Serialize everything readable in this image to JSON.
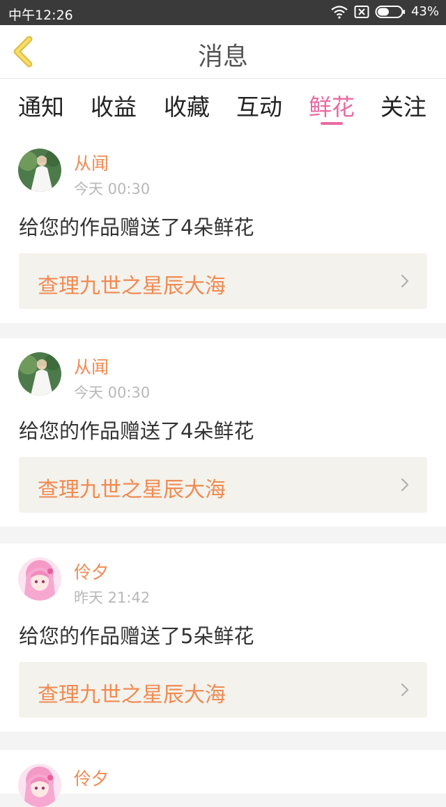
{
  "status_bar": {
    "time": "中午12:26",
    "battery": "43%"
  },
  "nav": {
    "title": "消息"
  },
  "tabs": [
    {
      "label": "通知"
    },
    {
      "label": "收益"
    },
    {
      "label": "收藏"
    },
    {
      "label": "互动"
    },
    {
      "label": "鲜花",
      "active": true
    },
    {
      "label": "关注"
    }
  ],
  "messages": [
    {
      "user": "从闻",
      "time": "今天 00:30",
      "text": "给您的作品赠送了4朵鲜花",
      "work": "查理九世之星辰大海"
    },
    {
      "user": "从闻",
      "time": "今天 00:30",
      "text": "给您的作品赠送了4朵鲜花",
      "work": "查理九世之星辰大海"
    },
    {
      "user": "伶夕",
      "time": "昨天 21:42",
      "text": "给您的作品赠送了5朵鲜花",
      "work": "查理九世之星辰大海"
    },
    {
      "user": "伶夕"
    }
  ],
  "colors": {
    "accent": "#e96aa2",
    "username": "#f08a52",
    "status_bar_bg": "#3a3a3a"
  }
}
